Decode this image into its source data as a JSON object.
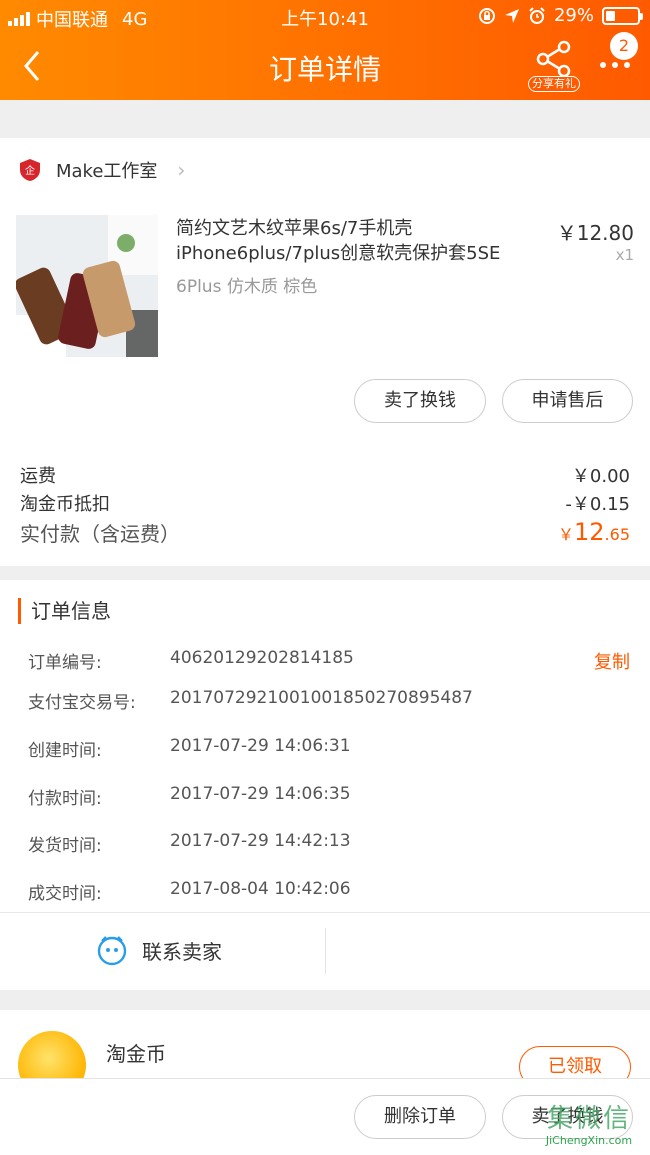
{
  "status_bar": {
    "carrier": "中国联通",
    "network": "4G",
    "time": "上午10:41",
    "battery": "29%"
  },
  "nav": {
    "title": "订单详情",
    "share_label": "分享有礼",
    "badge_count": "2"
  },
  "shop": {
    "name": "Make工作室"
  },
  "product": {
    "title": "简约文艺木纹苹果6s/7手机壳iPhone6plus/7plus创意软壳保护套5SE",
    "sku": "6Plus 仿木质 棕色",
    "price": "￥12.80",
    "qty": "x1"
  },
  "item_buttons": {
    "sell": "卖了换钱",
    "after_sale": "申请售后"
  },
  "costs": {
    "shipping_label": "运费",
    "shipping_value": "￥0.00",
    "coin_label": "淘金币抵扣",
    "coin_value": "-￥0.15",
    "paid_label": "实付款（含运费）",
    "paid_currency": "￥",
    "paid_int": "12",
    "paid_dec": ".65"
  },
  "order_info": {
    "title": "订单信息",
    "copy_label": "复制",
    "rows": [
      {
        "key": "订单编号:",
        "value": "40620129202814185"
      },
      {
        "key": "支付宝交易号:",
        "value": "2017072921001001850270895487"
      },
      {
        "key": "创建时间:",
        "value": "2017-07-29 14:06:31"
      },
      {
        "key": "付款时间:",
        "value": "2017-07-29 14:06:35"
      },
      {
        "key": "发货时间:",
        "value": "2017-07-29 14:42:13"
      },
      {
        "key": "成交时间:",
        "value": "2017-08-04 10:42:06"
      }
    ]
  },
  "contact": {
    "label": "联系卖家"
  },
  "coins": {
    "title": "淘金币",
    "claimed": "已领取"
  },
  "bottom": {
    "delete_order": "删除订单",
    "sell": "卖了换钱"
  },
  "watermark": {
    "text": "集微信",
    "sub": "JiChengXin.com"
  },
  "colors": {
    "accent": "#ff5a00",
    "header_start": "#ff8a00"
  }
}
